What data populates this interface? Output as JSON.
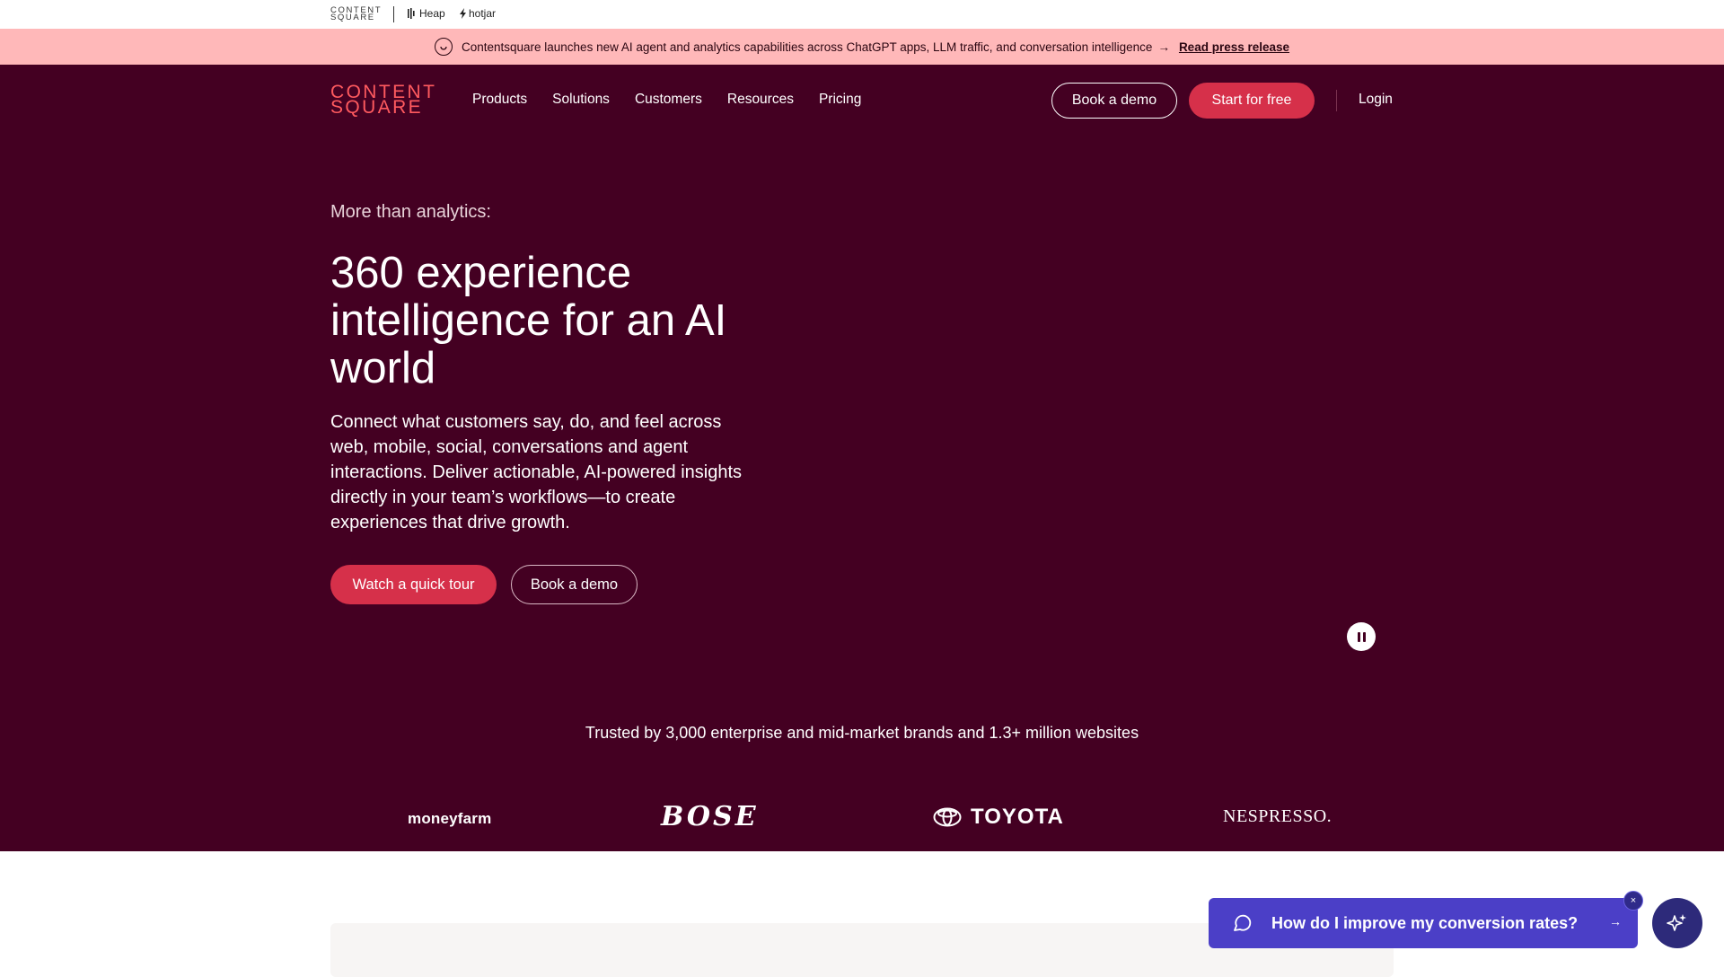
{
  "brands_bar": {
    "contentsquare": "CONTENT SQUARE",
    "heap": "Heap",
    "hotjar": "hotjar"
  },
  "announcement": {
    "text": "Contentsquare launches new AI agent and analytics capabilities across ChatGPT apps, LLM traffic, and conversation intelligence",
    "arrow": "→",
    "link": "Read press release"
  },
  "header": {
    "logo_line1": "CONTENT",
    "logo_line2": "SQUARE",
    "nav": [
      "Products",
      "Solutions",
      "Customers",
      "Resources",
      "Pricing"
    ],
    "book_demo": "Book a demo",
    "start_free": "Start for free",
    "login": "Login"
  },
  "hero": {
    "eyebrow": "More than analytics:",
    "headline": "360 experience intelligence for an AI world",
    "subcopy": "Connect what customers say, do, and feel across web, mobile, social, conversations and agent interactions. Deliver actionable, AI-powered insights directly in your team’s workflows—to create experiences that drive growth.",
    "cta_primary": "Watch a quick tour",
    "cta_secondary": "Book a demo"
  },
  "trusted": {
    "text": "Trusted by 3,000 enterprise and mid-market brands and 1.3+ million websites",
    "logos": [
      "moneyfarm",
      "BOSE",
      "TOYOTA",
      "NESPRESSO."
    ]
  },
  "chat": {
    "question": "How do I improve my conversion rates?",
    "arrow": "→",
    "close": "×"
  },
  "colors": {
    "hero_bg": "#440022",
    "announcement_bg": "#ffb8b9",
    "accent_red": "#d6304a",
    "logo_coral": "#ff5a5f",
    "chat_bg": "#4b3fc7"
  }
}
